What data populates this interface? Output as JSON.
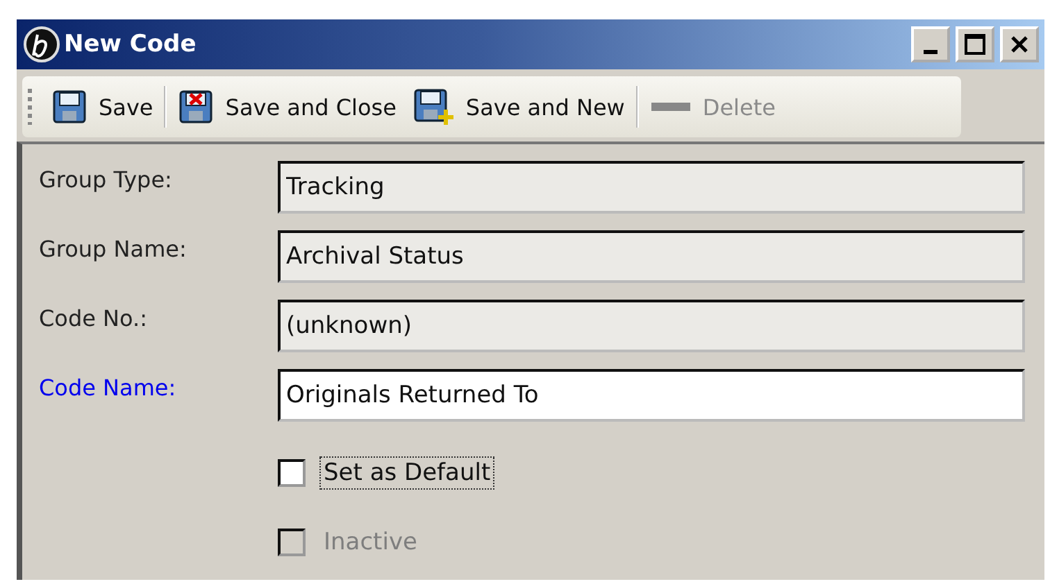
{
  "window": {
    "title": "New Code"
  },
  "toolbar": [
    {
      "label": "Save",
      "kind": "save",
      "disabled": false,
      "separator_after": true
    },
    {
      "label": "Save and Close",
      "kind": "save-close",
      "disabled": false,
      "separator_after": false
    },
    {
      "label": "Save and New",
      "kind": "save-new",
      "disabled": false,
      "separator_after": true
    },
    {
      "label": "Delete",
      "kind": "delete",
      "disabled": true,
      "separator_after": false
    }
  ],
  "fields": [
    {
      "label": "Group Type:",
      "value": "Tracking",
      "readonly": true,
      "required": false
    },
    {
      "label": "Group Name:",
      "value": "Archival Status",
      "readonly": true,
      "required": false
    },
    {
      "label": "Code No.:",
      "value": "(unknown)",
      "readonly": true,
      "required": false
    },
    {
      "label": "Code Name:",
      "value": "Originals Returned To",
      "readonly": false,
      "required": true
    }
  ],
  "checkboxes": [
    {
      "label": "Set as Default",
      "checked": false,
      "disabled": false,
      "focused": true
    },
    {
      "label": "Inactive",
      "checked": false,
      "disabled": true,
      "focused": false
    }
  ]
}
